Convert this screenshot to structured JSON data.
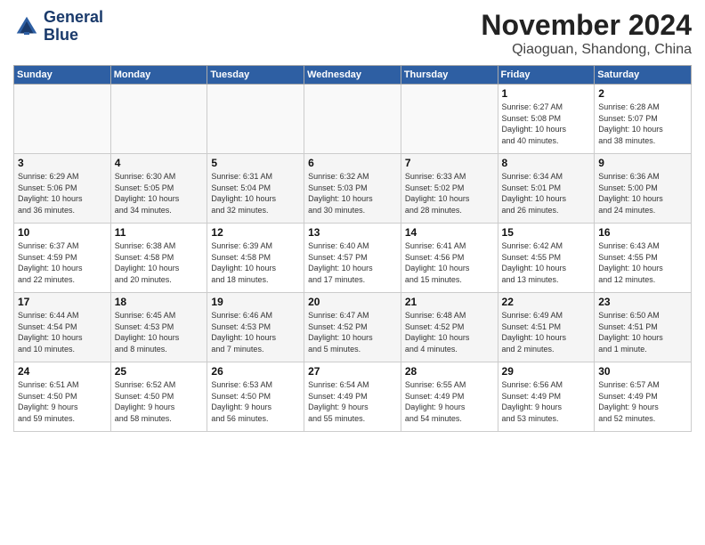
{
  "header": {
    "logo_line1": "General",
    "logo_line2": "Blue",
    "month_title": "November 2024",
    "location": "Qiaoguan, Shandong, China"
  },
  "days_of_week": [
    "Sunday",
    "Monday",
    "Tuesday",
    "Wednesday",
    "Thursday",
    "Friday",
    "Saturday"
  ],
  "weeks": [
    [
      {
        "day": "",
        "info": ""
      },
      {
        "day": "",
        "info": ""
      },
      {
        "day": "",
        "info": ""
      },
      {
        "day": "",
        "info": ""
      },
      {
        "day": "",
        "info": ""
      },
      {
        "day": "1",
        "info": "Sunrise: 6:27 AM\nSunset: 5:08 PM\nDaylight: 10 hours\nand 40 minutes."
      },
      {
        "day": "2",
        "info": "Sunrise: 6:28 AM\nSunset: 5:07 PM\nDaylight: 10 hours\nand 38 minutes."
      }
    ],
    [
      {
        "day": "3",
        "info": "Sunrise: 6:29 AM\nSunset: 5:06 PM\nDaylight: 10 hours\nand 36 minutes."
      },
      {
        "day": "4",
        "info": "Sunrise: 6:30 AM\nSunset: 5:05 PM\nDaylight: 10 hours\nand 34 minutes."
      },
      {
        "day": "5",
        "info": "Sunrise: 6:31 AM\nSunset: 5:04 PM\nDaylight: 10 hours\nand 32 minutes."
      },
      {
        "day": "6",
        "info": "Sunrise: 6:32 AM\nSunset: 5:03 PM\nDaylight: 10 hours\nand 30 minutes."
      },
      {
        "day": "7",
        "info": "Sunrise: 6:33 AM\nSunset: 5:02 PM\nDaylight: 10 hours\nand 28 minutes."
      },
      {
        "day": "8",
        "info": "Sunrise: 6:34 AM\nSunset: 5:01 PM\nDaylight: 10 hours\nand 26 minutes."
      },
      {
        "day": "9",
        "info": "Sunrise: 6:36 AM\nSunset: 5:00 PM\nDaylight: 10 hours\nand 24 minutes."
      }
    ],
    [
      {
        "day": "10",
        "info": "Sunrise: 6:37 AM\nSunset: 4:59 PM\nDaylight: 10 hours\nand 22 minutes."
      },
      {
        "day": "11",
        "info": "Sunrise: 6:38 AM\nSunset: 4:58 PM\nDaylight: 10 hours\nand 20 minutes."
      },
      {
        "day": "12",
        "info": "Sunrise: 6:39 AM\nSunset: 4:58 PM\nDaylight: 10 hours\nand 18 minutes."
      },
      {
        "day": "13",
        "info": "Sunrise: 6:40 AM\nSunset: 4:57 PM\nDaylight: 10 hours\nand 17 minutes."
      },
      {
        "day": "14",
        "info": "Sunrise: 6:41 AM\nSunset: 4:56 PM\nDaylight: 10 hours\nand 15 minutes."
      },
      {
        "day": "15",
        "info": "Sunrise: 6:42 AM\nSunset: 4:55 PM\nDaylight: 10 hours\nand 13 minutes."
      },
      {
        "day": "16",
        "info": "Sunrise: 6:43 AM\nSunset: 4:55 PM\nDaylight: 10 hours\nand 12 minutes."
      }
    ],
    [
      {
        "day": "17",
        "info": "Sunrise: 6:44 AM\nSunset: 4:54 PM\nDaylight: 10 hours\nand 10 minutes."
      },
      {
        "day": "18",
        "info": "Sunrise: 6:45 AM\nSunset: 4:53 PM\nDaylight: 10 hours\nand 8 minutes."
      },
      {
        "day": "19",
        "info": "Sunrise: 6:46 AM\nSunset: 4:53 PM\nDaylight: 10 hours\nand 7 minutes."
      },
      {
        "day": "20",
        "info": "Sunrise: 6:47 AM\nSunset: 4:52 PM\nDaylight: 10 hours\nand 5 minutes."
      },
      {
        "day": "21",
        "info": "Sunrise: 6:48 AM\nSunset: 4:52 PM\nDaylight: 10 hours\nand 4 minutes."
      },
      {
        "day": "22",
        "info": "Sunrise: 6:49 AM\nSunset: 4:51 PM\nDaylight: 10 hours\nand 2 minutes."
      },
      {
        "day": "23",
        "info": "Sunrise: 6:50 AM\nSunset: 4:51 PM\nDaylight: 10 hours\nand 1 minute."
      }
    ],
    [
      {
        "day": "24",
        "info": "Sunrise: 6:51 AM\nSunset: 4:50 PM\nDaylight: 9 hours\nand 59 minutes."
      },
      {
        "day": "25",
        "info": "Sunrise: 6:52 AM\nSunset: 4:50 PM\nDaylight: 9 hours\nand 58 minutes."
      },
      {
        "day": "26",
        "info": "Sunrise: 6:53 AM\nSunset: 4:50 PM\nDaylight: 9 hours\nand 56 minutes."
      },
      {
        "day": "27",
        "info": "Sunrise: 6:54 AM\nSunset: 4:49 PM\nDaylight: 9 hours\nand 55 minutes."
      },
      {
        "day": "28",
        "info": "Sunrise: 6:55 AM\nSunset: 4:49 PM\nDaylight: 9 hours\nand 54 minutes."
      },
      {
        "day": "29",
        "info": "Sunrise: 6:56 AM\nSunset: 4:49 PM\nDaylight: 9 hours\nand 53 minutes."
      },
      {
        "day": "30",
        "info": "Sunrise: 6:57 AM\nSunset: 4:49 PM\nDaylight: 9 hours\nand 52 minutes."
      }
    ]
  ]
}
